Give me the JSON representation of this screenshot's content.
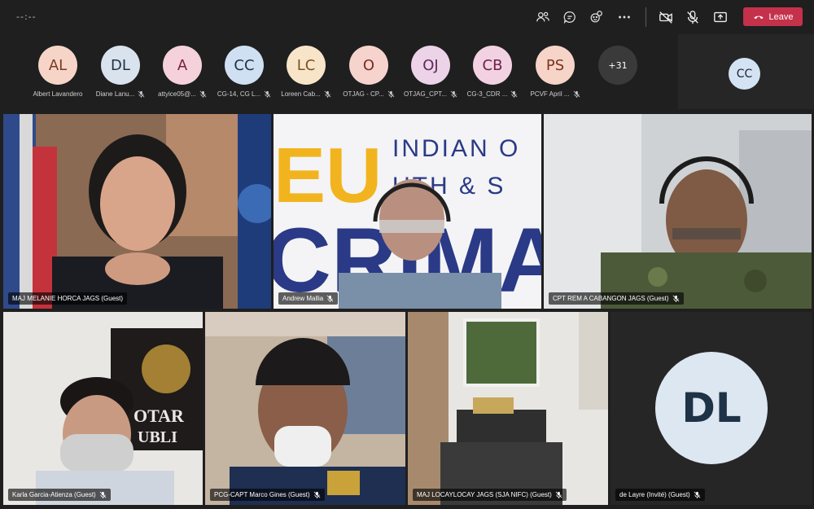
{
  "timer": "--:--",
  "leave_label": "Leave",
  "colors": {
    "leave": "#c4314b",
    "active_outline": "#8a8ae0"
  },
  "toolbar_icons": [
    "people-icon",
    "chat-icon",
    "reactions-icon",
    "more-icon",
    "camera-off-icon",
    "mic-off-icon",
    "share-icon",
    "phone-icon"
  ],
  "participants": [
    {
      "initials": "AL",
      "name": "Albert Lavandero",
      "color": "#f6d5c8",
      "muted": false
    },
    {
      "initials": "DL",
      "name": "Diane Lanu...",
      "color": "#d9e3ee",
      "muted": true
    },
    {
      "initials": "A",
      "name": "attyice05@...",
      "color": "#f5d1dc",
      "muted": true
    },
    {
      "initials": "CC",
      "name": "CG-14, CG L...",
      "color": "#cfe0f2",
      "muted": true
    },
    {
      "initials": "LC",
      "name": "Loreen Cab...",
      "color": "#f8e5c9",
      "muted": true
    },
    {
      "initials": "O",
      "name": "OTJAG - CP...",
      "color": "#f6d3cd",
      "muted": true
    },
    {
      "initials": "OJ",
      "name": "OTJAG_CPT...",
      "color": "#ecd3e8",
      "muted": true
    },
    {
      "initials": "CB",
      "name": "CG-3_CDR ...",
      "color": "#f2d2e2",
      "muted": true
    },
    {
      "initials": "PS",
      "name": "PCVF April ...",
      "color": "#f6d4c8",
      "muted": true
    }
  ],
  "more_count": "+31",
  "side_participant": {
    "initials": "CC"
  },
  "videos": [
    {
      "name": "MAJ MELANIE HORCA JAGS (Guest)",
      "muted": false
    },
    {
      "name": "Andrew Mallia",
      "muted": true,
      "banner_line1": "INDIAN O",
      "banner_line2": "UTH & S",
      "banner_big1": "EU",
      "banner_big2": "CRIMA"
    },
    {
      "name": "CPT REM A CABANGON JAGS (Guest)",
      "muted": true
    },
    {
      "name": "Karla Garcia-Atienza (Guest)",
      "muted": true,
      "sign_text": "OTAR",
      "sign_text2": "UBLI"
    },
    {
      "name": "PCG-CAPT Marco Gines (Guest)",
      "muted": true
    },
    {
      "name": "MAJ LOCAYLOCAY JAGS (SJA NIFC) (Guest)",
      "muted": true
    },
    {
      "name": "de Layre (Invité) (Guest)",
      "muted": true,
      "initials": "DL"
    }
  ]
}
